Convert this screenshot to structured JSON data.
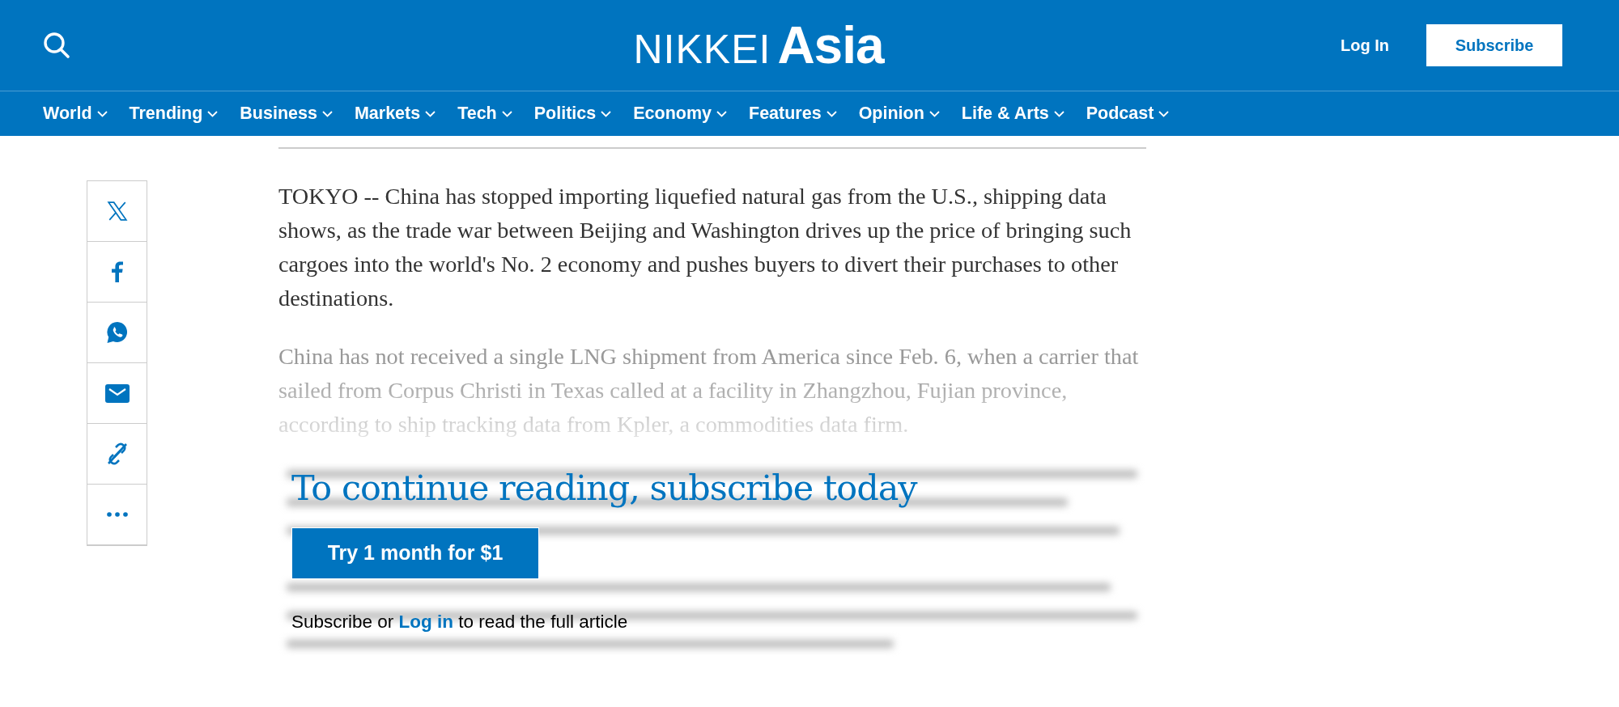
{
  "header": {
    "logo": {
      "prefix": "NIKKEI",
      "name": "Asia"
    },
    "login": "Log In",
    "subscribe": "Subscribe"
  },
  "nav": [
    {
      "label": "World"
    },
    {
      "label": "Trending"
    },
    {
      "label": "Business"
    },
    {
      "label": "Markets"
    },
    {
      "label": "Tech"
    },
    {
      "label": "Politics"
    },
    {
      "label": "Economy"
    },
    {
      "label": "Features"
    },
    {
      "label": "Opinion"
    },
    {
      "label": "Life & Arts"
    },
    {
      "label": "Podcast"
    }
  ],
  "share": [
    {
      "kind": "x"
    },
    {
      "kind": "facebook"
    },
    {
      "kind": "whatsapp"
    },
    {
      "kind": "email"
    },
    {
      "kind": "link"
    },
    {
      "kind": "more"
    }
  ],
  "article": {
    "paragraphs": [
      "TOKYO -- China has stopped importing liquefied natural gas from the U.S., shipping data shows, as the trade war between Beijing and Washington drives up the price of bringing such cargoes into the world's No. 2 economy and pushes buyers to divert their purchases to other destinations.",
      "China has not received a single LNG shipment from America since Feb. 6, when a carrier that sailed from Corpus Christi in Texas called at a facility in Zhangzhou, Fujian province, according to ship tracking data from Kpler, a commodities data firm."
    ]
  },
  "paywall": {
    "title": "To continue reading, subscribe today",
    "button": "Try 1 month for $1",
    "before": "Subscribe or",
    "link": "Log in",
    "after": "to read the full article"
  }
}
